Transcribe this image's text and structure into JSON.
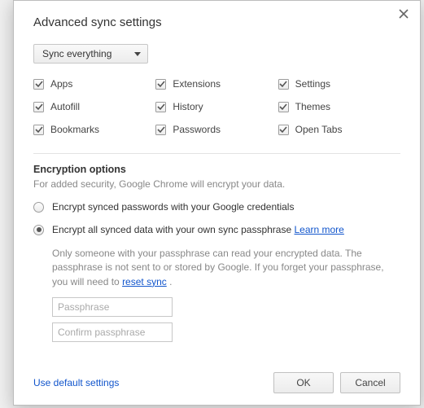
{
  "title": "Advanced sync settings",
  "syncMode": {
    "selected": "Sync everything"
  },
  "items": {
    "apps": "Apps",
    "autofill": "Autofill",
    "bookmarks": "Bookmarks",
    "extensions": "Extensions",
    "history": "History",
    "passwords": "Passwords",
    "settings": "Settings",
    "themes": "Themes",
    "openTabs": "Open Tabs"
  },
  "encryption": {
    "heading": "Encryption options",
    "desc": "For added security, Google Chrome will encrypt your data.",
    "optGoogle": "Encrypt synced passwords with your Google credentials",
    "optPassphrasePrefix": "Encrypt all synced data with your own sync passphrase ",
    "learnMore": "Learn more",
    "warnPrefix": "Only someone with your passphrase can read your encrypted data. The passphrase is not sent to or stored by Google. If you forget your passphrase, you will need to ",
    "resetSync": "reset sync",
    "warnSuffix": " .",
    "placeholder1": "Passphrase",
    "placeholder2": "Confirm passphrase"
  },
  "footer": {
    "defaults": "Use default settings",
    "ok": "OK",
    "cancel": "Cancel"
  }
}
